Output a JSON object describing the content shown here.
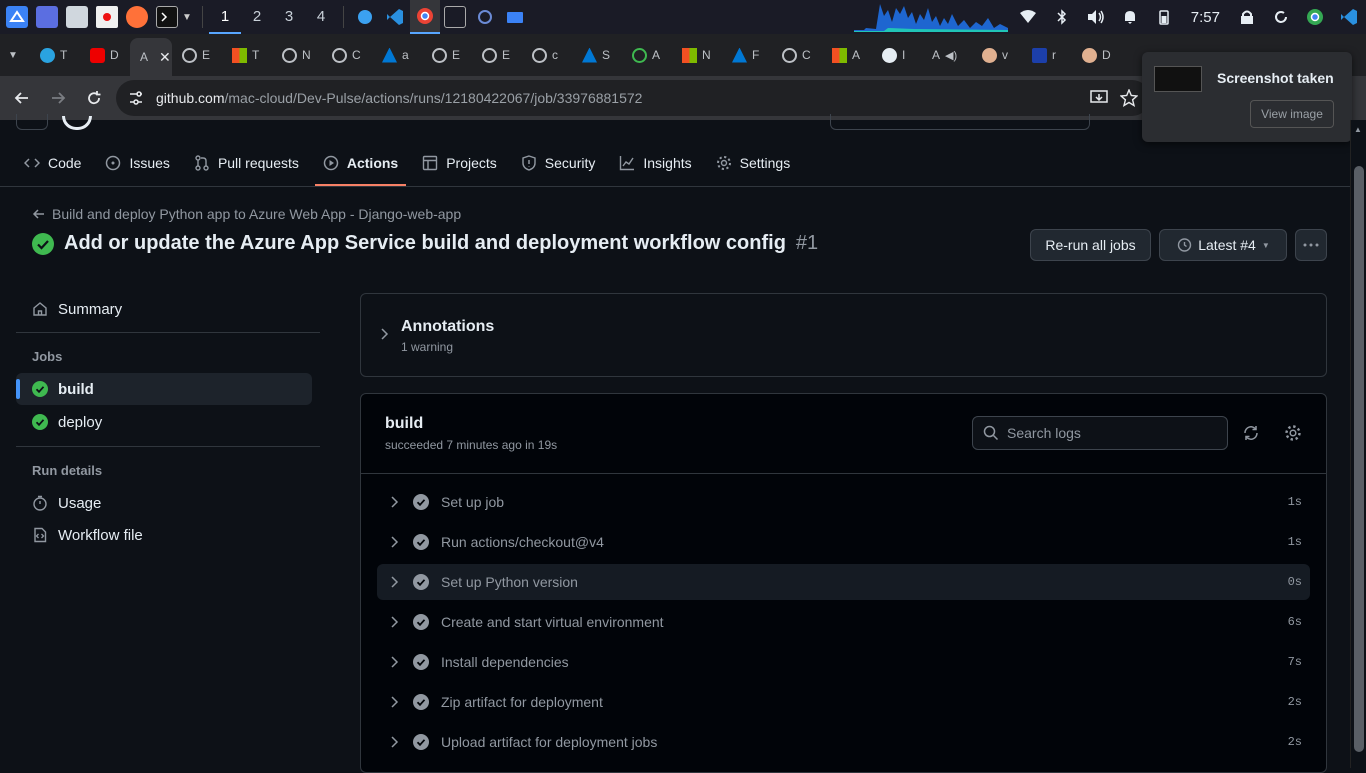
{
  "taskbar": {
    "workspaces": [
      "1",
      "2",
      "3",
      "4"
    ],
    "clock": "7:57"
  },
  "browser": {
    "tab_labels": [
      "T",
      "D",
      "A",
      "E",
      "T",
      "N",
      "C",
      "a",
      "E",
      "E",
      "c",
      "S",
      "A",
      "N",
      "F",
      "C",
      "A",
      "I",
      "A",
      "v",
      "r",
      "D"
    ],
    "url_host": "github.com",
    "url_path": "/mac-cloud/Dev-Pulse/actions/runs/12180422067/job/33976881572"
  },
  "toast": {
    "title": "Screenshot taken",
    "button": "View image"
  },
  "repo_nav": {
    "items": [
      {
        "label": "Code",
        "icon": "code-icon"
      },
      {
        "label": "Issues",
        "icon": "issue-icon"
      },
      {
        "label": "Pull requests",
        "icon": "pull-request-icon"
      },
      {
        "label": "Actions",
        "icon": "play-icon"
      },
      {
        "label": "Projects",
        "icon": "table-icon"
      },
      {
        "label": "Security",
        "icon": "shield-icon"
      },
      {
        "label": "Insights",
        "icon": "graph-icon"
      },
      {
        "label": "Settings",
        "icon": "gear-icon"
      }
    ],
    "active": "Actions"
  },
  "header": {
    "breadcrumb": "Build and deploy Python app to Azure Web App - Django-web-app",
    "title": "Add or update the Azure App Service build and deployment workflow config",
    "run_number": "#1",
    "rerun_button": "Re-run all jobs",
    "latest_button": "Latest #4"
  },
  "sidebar": {
    "summary": "Summary",
    "jobs_label": "Jobs",
    "jobs": [
      "build",
      "deploy"
    ],
    "run_details_label": "Run details",
    "usage": "Usage",
    "workflow_file": "Workflow file"
  },
  "annotations": {
    "title": "Annotations",
    "subtitle": "1 warning"
  },
  "build": {
    "title": "build",
    "subtitle": "succeeded 7 minutes ago in 19s",
    "search_placeholder": "Search logs",
    "steps": [
      {
        "name": "Set up job",
        "duration": "1s"
      },
      {
        "name": "Run actions/checkout@v4",
        "duration": "1s"
      },
      {
        "name": "Set up Python version",
        "duration": "0s"
      },
      {
        "name": "Create and start virtual environment",
        "duration": "6s"
      },
      {
        "name": "Install dependencies",
        "duration": "7s"
      },
      {
        "name": "Zip artifact for deployment",
        "duration": "2s"
      },
      {
        "name": "Upload artifact for deployment jobs",
        "duration": "2s"
      }
    ]
  },
  "colors": {
    "success": "#3fb950",
    "accent_underline": "#f78166",
    "active_indicator": "#4493f8"
  }
}
